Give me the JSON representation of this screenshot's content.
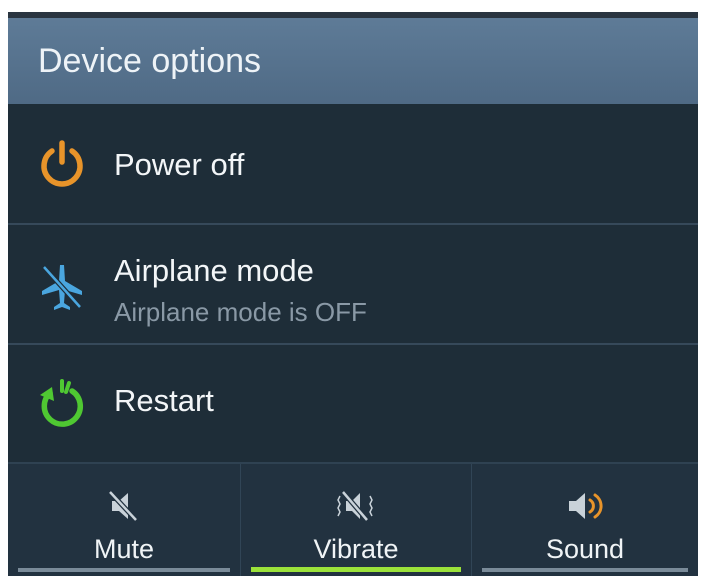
{
  "dialog": {
    "title": "Device options"
  },
  "options": [
    {
      "label": "Power off",
      "icon": "power-icon",
      "icon_color": "#e8942a"
    },
    {
      "label": "Airplane mode",
      "sublabel": "Airplane mode is OFF",
      "icon": "airplane-off-icon",
      "icon_color": "#4aa6df"
    },
    {
      "label": "Restart",
      "icon": "restart-icon",
      "icon_color": "#4fc832"
    }
  ],
  "sound_modes": [
    {
      "label": "Mute",
      "icon": "mute-icon",
      "active": false
    },
    {
      "label": "Vibrate",
      "icon": "vibrate-icon",
      "active": true
    },
    {
      "label": "Sound",
      "icon": "sound-icon",
      "active": false
    }
  ],
  "colors": {
    "background": "#1e2d38",
    "header": "#56728e",
    "active_indicator": "#9be23a",
    "inactive_indicator": "#7a8b99"
  }
}
